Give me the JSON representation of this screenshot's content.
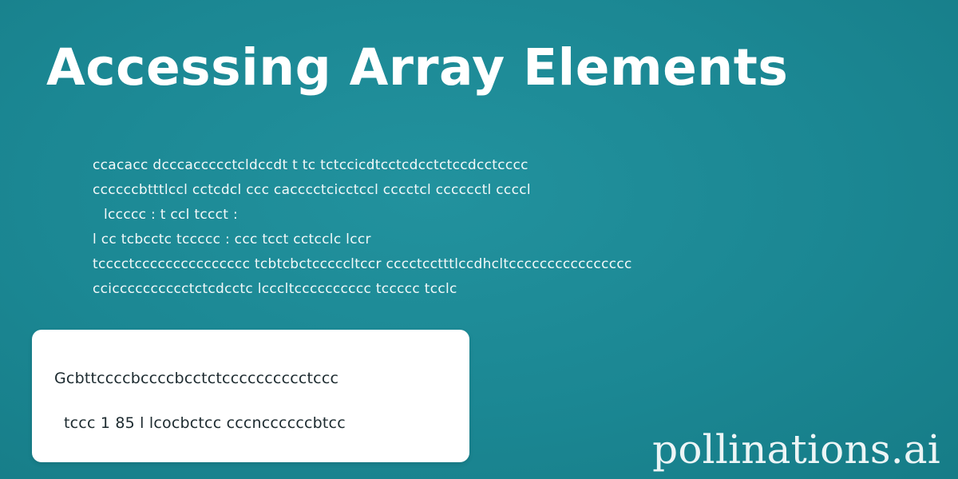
{
  "slide": {
    "title": "Accessing Array Elements",
    "body_lines": [
      "ccacacc dcccaccccctcldccdt t tc tctccicdtcctcdcctctccdcctcccc",
      "ccccccbtttlccl cctcdcl ccc cacccctcicctccl cccctcl cccccctl ccccl",
      "lccccc : t ccl tccct :",
      "l cc tcbcctc tccccc : ccc tcct cctcclc lccr",
      "tcccctccccccccccccccc tcbtcbctcccccltccr cccctcctttlccdhcltcccccccccccccccc",
      "ccicccccccccctctcdcctc lcccltcccccccccc tccccc tcclc"
    ],
    "code_lines": [
      "Gcbttccccbccccbcctctcccccccccctccc",
      "tccc 1 85 l lcocbctcc cccnccccccbtcc"
    ],
    "watermark": "pollinations.ai"
  },
  "colors": {
    "background": "#1d8a97",
    "title_text": "#ffffff",
    "card_background": "#ffffff",
    "card_text": "#1c2a2f"
  }
}
